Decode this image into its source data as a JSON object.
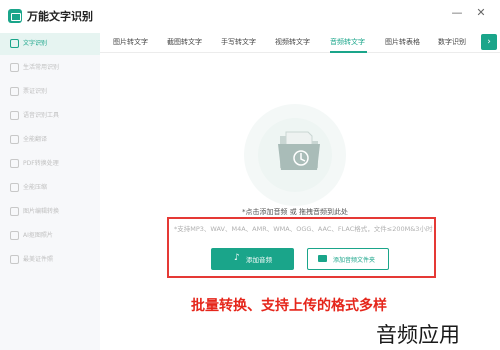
{
  "app": {
    "title": "万能文字识别"
  },
  "window_controls": {
    "minimize": "—",
    "close": "✕"
  },
  "sidebar": {
    "items": [
      {
        "label": "文字识别",
        "icon": "text-recognition-icon",
        "active": true
      },
      {
        "label": "生活常用识别",
        "icon": "life-icon",
        "active": false
      },
      {
        "label": "票证识别",
        "icon": "ticket-icon",
        "active": false
      },
      {
        "label": "语音识别工具",
        "icon": "voice-icon",
        "active": false
      },
      {
        "label": "全能翻译",
        "icon": "translate-icon",
        "active": false
      },
      {
        "label": "PDF转换处理",
        "icon": "pdf-icon",
        "active": false
      },
      {
        "label": "全能压缩",
        "icon": "compress-icon",
        "active": false
      },
      {
        "label": "图片编辑转换",
        "icon": "image-edit-icon",
        "active": false
      },
      {
        "label": "AI抠图照片",
        "icon": "ai-cutout-icon",
        "active": false
      },
      {
        "label": "最美证件照",
        "icon": "id-photo-icon",
        "active": false
      }
    ]
  },
  "tabs": [
    {
      "label": "图片转文字",
      "active": false
    },
    {
      "label": "截图转文字",
      "active": false
    },
    {
      "label": "手写转文字",
      "active": false
    },
    {
      "label": "视频转文字",
      "active": false
    },
    {
      "label": "音频转文字",
      "active": true
    },
    {
      "label": "图片转表格",
      "active": false
    },
    {
      "label": "数字识别",
      "active": false
    }
  ],
  "main": {
    "hint": "*点击添加音频 或 拖拽音频到此处",
    "formats": "*支持MP3、WAV、M4A、AMR、WMA、OGG、AAC、FLAC格式，文件≤200M&3小时",
    "add_audio_button": "添加音频",
    "add_folder_button": "添加音频文件夹"
  },
  "annotation": {
    "caption": "批量转换、支持上传的格式多样"
  },
  "watermark": {
    "text": "音频应用"
  },
  "colors": {
    "accent": "#1aa58a",
    "annotation_red": "#e5261b"
  }
}
